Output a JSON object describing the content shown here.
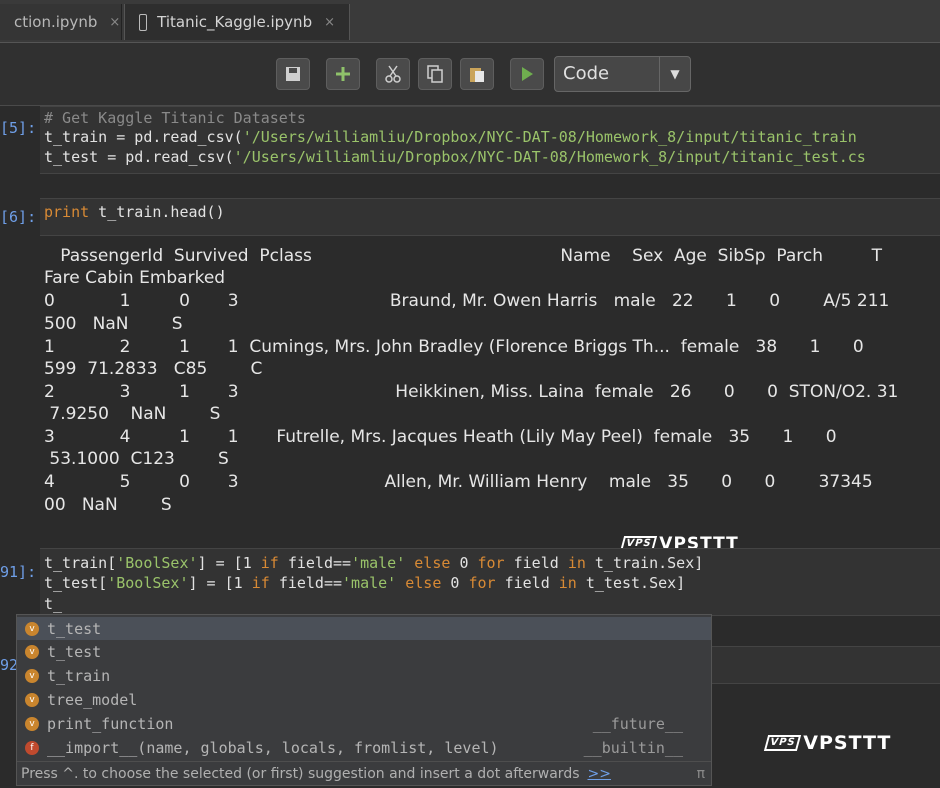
{
  "tabs": [
    {
      "label": "ction.ipynb",
      "close": "×"
    },
    {
      "label": "Titanic_Kaggle.ipynb",
      "close": "×"
    }
  ],
  "toolbar": {
    "icons": [
      "save-icon",
      "plus-icon",
      "cut-icon",
      "copy-icon",
      "paste-icon",
      "run-icon"
    ],
    "cell_type": "Code"
  },
  "cells": {
    "c5": {
      "prompt": "[5]:",
      "line1": "# Get Kaggle Titanic Datasets",
      "line2_pre": "t_train = pd.read_csv(",
      "line2_str": "'/Users/williamliu/Dropbox/NYC-DAT-08/Homework_8/input/titanic_train",
      "line3_pre": "t_test = pd.read_csv(",
      "line3_str": "'/Users/williamliu/Dropbox/NYC-DAT-08/Homework_8/input/titanic_test.cs"
    },
    "c6": {
      "prompt": "[6]:",
      "kw": "print",
      "rest": " t_train.head()"
    },
    "output": [
      "   PassengerId  Survived  Pclass                                              Name    Sex  Age  SibSp  Parch         T",
      "Fare Cabin Embarked",
      "0            1         0       3                            Braund, Mr. Owen Harris   male   22      1      0        A/5 211",
      "500   NaN        S",
      "1            2         1       1  Cumings, Mrs. John Bradley (Florence Briggs Th...  female   38      1      0",
      "599  71.2833   C85        C",
      "2            3         1       3                             Heikkinen, Miss. Laina  female   26      0      0  STON/O2. 31",
      " 7.9250    NaN        S",
      "3            4         1       1       Futrelle, Mrs. Jacques Heath (Lily May Peel)  female   35      1      0",
      " 53.1000  C123        S",
      "4            5         0       3                           Allen, Mr. William Henry    male   35      0      0        37345",
      "00   NaN        S"
    ],
    "c91": {
      "prompt": "91]:",
      "l1_a": "t_train[",
      "l1_s1": "'BoolSex'",
      "l1_b": "] = [",
      "l1_c": "1",
      "l1_kw1": " if ",
      "l1_d": "field==",
      "l1_s2": "'male'",
      "l1_kw2": " else ",
      "l1_e": "0",
      "l1_kw3": " for ",
      "l1_f": "field ",
      "l1_kw4": "in",
      "l1_g": " t_train.Sex]",
      "l2_a": "t_test[",
      "l2_b": "] = [",
      "l2_g": " t_test.Sex]",
      "l3": "t_"
    },
    "c92": {
      "prompt": "92"
    }
  },
  "autocomplete": {
    "items": [
      {
        "name": "t_test",
        "module": "",
        "icon": "variable-icon"
      },
      {
        "name": "t_test",
        "module": "",
        "icon": "variable-icon"
      },
      {
        "name": "t_train",
        "module": "",
        "icon": "variable-icon"
      },
      {
        "name": "tree_model",
        "module": "",
        "icon": "variable-icon"
      },
      {
        "name": "print_function",
        "module": "__future__",
        "icon": "variable-icon"
      },
      {
        "name": "__import__(name, globals, locals, fromlist, level)",
        "module": "__builtin__",
        "icon": "function-icon"
      }
    ],
    "footer": "Press ^. to choose the selected (or first) suggestion and insert a dot afterwards",
    "footer_link": ">>",
    "footer_pi": "π"
  },
  "watermark": "VPSTTT",
  "watermark_logo": "VPS"
}
